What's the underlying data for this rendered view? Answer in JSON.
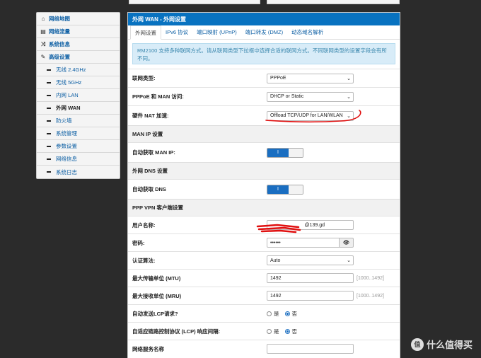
{
  "sidebar": {
    "items": [
      {
        "label": "网络地图",
        "icon": "home-icon",
        "glyph": "⌂"
      },
      {
        "label": "网络流量",
        "icon": "chart-icon",
        "glyph": "▤"
      },
      {
        "label": "系统信息",
        "icon": "shuffle-icon",
        "glyph": "⤨"
      },
      {
        "label": "高级设置",
        "icon": "wrench-icon",
        "glyph": "✎"
      }
    ],
    "subitems": [
      {
        "label": "无线 2.4GHz"
      },
      {
        "label": "无线 5GHz"
      },
      {
        "label": "内网 LAN"
      },
      {
        "label": "外网 WAN"
      },
      {
        "label": "防火墙"
      },
      {
        "label": "系统管理"
      },
      {
        "label": "参数设置"
      },
      {
        "label": "网络信息"
      },
      {
        "label": "系统日志"
      }
    ]
  },
  "panel": {
    "title": "外网 WAN - 外网设置",
    "tabs": [
      "外网设置",
      "IPv6 协议",
      "端口映射 (UPnP)",
      "端口转发 (DMZ)",
      "动态域名解析"
    ],
    "info": "RM2100 支持多种联网方式。请从联网类型下拉框中选择合适的联网方式。不同联网类型的设置字段会有所不同。"
  },
  "form": {
    "conn_type": {
      "label": "联网类型:",
      "value": "PPPoE"
    },
    "pppoe_man": {
      "label": "PPPoE 和 MAN 访问:",
      "value": "DHCP or Static"
    },
    "hw_nat": {
      "label": "硬件 NAT 加速:",
      "value": "Offload TCP/UDP for LAN/WLAN"
    },
    "man_ip_section": "MAN IP 设置",
    "man_ip_auto": {
      "label": "自动获取 MAN IP:",
      "toggle": "I"
    },
    "dns_section": "外网 DNS 设置",
    "dns_auto": {
      "label": "自动获取 DNS",
      "toggle": "I"
    },
    "vpn_section": "PPP VPN 客户端设置",
    "username": {
      "label": "用户名称:",
      "value": "@139.gd"
    },
    "password": {
      "label": "密码:",
      "value": "••••••",
      "eye": "👁"
    },
    "auth": {
      "label": "认证算法:",
      "value": "Auto"
    },
    "mtu": {
      "label": "最大传输单位 (MTU)",
      "value": "1492",
      "hint": "[1000..1492]"
    },
    "mru": {
      "label": "最大接收单位 (MRU)",
      "value": "1492",
      "hint": "[1000..1492]"
    },
    "lcp": {
      "label": "自动发送LCP请求?",
      "yes": "是",
      "no": "否"
    },
    "lcp_adaptive": {
      "label": "自适应链路控制协议 (LCP) 响应间隔:",
      "yes": "是",
      "no": "否"
    },
    "service_name": {
      "label": "网络服务名称",
      "value": ""
    }
  },
  "watermark": {
    "logo": "值",
    "text": "什么值得买"
  },
  "colors": {
    "header": "#0872c0",
    "link": "#0d5fa4",
    "toggle_on": "#1a6ec1",
    "annotation": "#e01010"
  }
}
